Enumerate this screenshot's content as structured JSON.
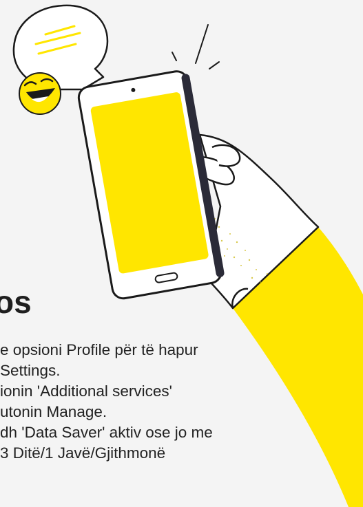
{
  "heading": "os",
  "steps": [
    "e opsioni Profile për të hapur",
    "Settings.",
    "ionin  'Additional services'",
    "utonin Manage.",
    "dh  'Data Saver' aktiv ose jo me",
    "3 Ditë/1 Javë/Gjithmonë"
  ],
  "colors": {
    "background": "#f4f4f4",
    "accent_yellow": "#ffe600",
    "ink": "#1a1a1a",
    "phone_frame": "#ffffff",
    "emoji_face": "#ffe600",
    "sleeve_shadow": "#e9d400"
  },
  "illustration": {
    "icons": [
      "speech-bubble-icon",
      "laughing-emoji-icon",
      "phone-icon",
      "hand-icon"
    ]
  }
}
